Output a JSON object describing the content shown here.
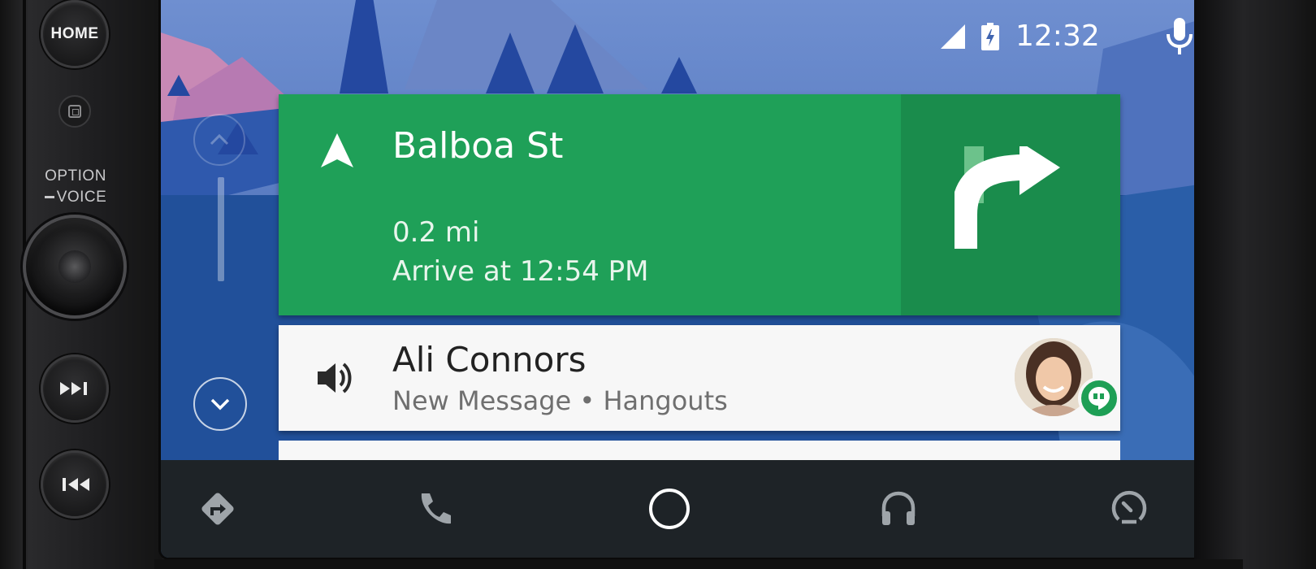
{
  "hardware": {
    "home_label": "HOME",
    "option_label": "OPTION",
    "voice_label": "VOICE"
  },
  "status_bar": {
    "time": "12:32",
    "icons": [
      "signal-icon",
      "battery-charging-icon",
      "mic-icon"
    ]
  },
  "navigation_card": {
    "street": "Balboa St",
    "distance": "0.2 mi",
    "arrival": "Arrive at 12:54 PM",
    "maneuver_icon": "turn-right-icon",
    "color": "#1fa058"
  },
  "message_card": {
    "sender": "Ali Connors",
    "subtitle": "New Message • Hangouts",
    "icon": "speaker-icon",
    "badge_icon": "hangouts-icon"
  },
  "bottom_nav": {
    "items": [
      "navigation-icon",
      "phone-icon",
      "home-circle-icon",
      "headphones-icon",
      "exit-dashboard-icon"
    ]
  }
}
